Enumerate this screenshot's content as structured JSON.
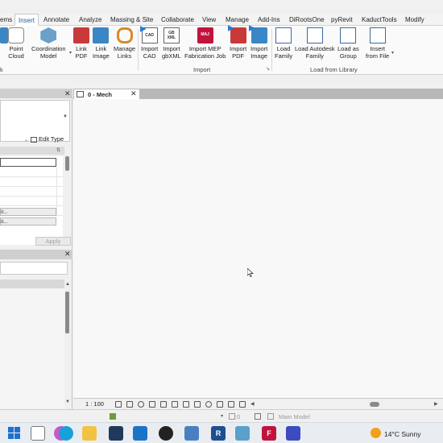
{
  "ribbon": {
    "tabs": [
      {
        "label": "ems",
        "active": false
      },
      {
        "label": "Insert",
        "active": true
      },
      {
        "label": "Annotate",
        "active": false
      },
      {
        "label": "Analyze",
        "active": false
      },
      {
        "label": "Massing & Site",
        "active": false
      },
      {
        "label": "Collaborate",
        "active": false
      },
      {
        "label": "View",
        "active": false
      },
      {
        "label": "Manage",
        "active": false
      },
      {
        "label": "Add-Ins",
        "active": false
      },
      {
        "label": "DiRootsOne",
        "active": false
      },
      {
        "label": "pyRevit",
        "active": false
      },
      {
        "label": "KaductTools",
        "active": false
      },
      {
        "label": "Modify",
        "active": false
      }
    ],
    "link_group_label_tail": "k",
    "buttons": {
      "point_cloud": "Point\nCloud",
      "coordination_model": "Coordination\nModel",
      "link_pdf": "Link\nPDF",
      "link_image": "Link\nImage",
      "manage_links": "Manage\nLinks",
      "import_cad": "Import\nCAD",
      "import_gbxml": "Import\ngbXML",
      "import_mep": "Import MEP\nFabrication Job",
      "import_pdf": "Import\nPDF",
      "import_image": "Import\nImage",
      "load_family": "Load\nFamily",
      "load_autodesk_family": "Load Autodesk\nFamily",
      "load_as_group": "Load as\nGroup",
      "insert_from_file": "Insert\nfrom File"
    },
    "icon_text": {
      "cad": "CAD",
      "gb": "GB\nXML",
      "maj": "MAJ"
    },
    "groups": {
      "import": "Import",
      "load_from_library": "Load from Library"
    }
  },
  "properties": {
    "edit_type": "Edit Type",
    "buttons": [
      "it...",
      "it..."
    ],
    "apply": "Apply"
  },
  "view": {
    "tab_label": "0 - Mech",
    "scale": "1 : 100"
  },
  "status": {
    "workset_value": ":0",
    "model": "Main Model"
  },
  "taskbar": {
    "weather": "14°C  Sunny",
    "icon_labels": {
      "revit": "R",
      "revit2": "R",
      "fab": "F"
    }
  },
  "colors": {
    "accent": "#1e5b96",
    "pdf_red": "#c83a3a",
    "image_blue": "#3b86c4",
    "link_orange": "#d98a2a",
    "mep_red": "#c0143c"
  }
}
